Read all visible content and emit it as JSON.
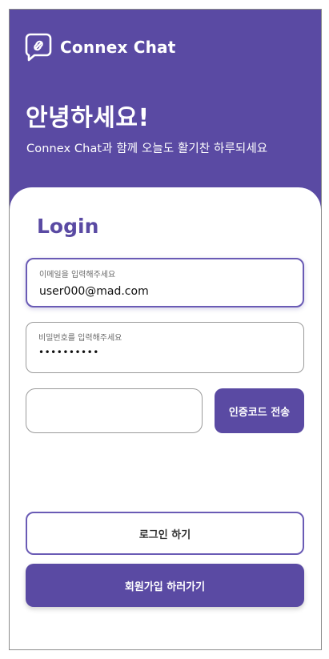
{
  "brand": {
    "name": "Connex Chat",
    "icon": "chat-link-icon"
  },
  "header": {
    "greeting": "안녕하세요!",
    "subtitle": "Connex Chat과 함께 오늘도 활기찬 하루되세요"
  },
  "login": {
    "title": "Login",
    "email": {
      "label": "이메일을 입력해주세요",
      "value": "user000@mad.com"
    },
    "password": {
      "label": "비밀번호를 입력해주세요",
      "value": "••••••••••"
    },
    "auth_code": {
      "value": ""
    },
    "send_code_label": "인증코드 전송",
    "login_label": "로그인 하기",
    "signup_label": "회원가입 하러가기"
  },
  "colors": {
    "primary": "#5a4aa3",
    "border": "#6a5bb5"
  }
}
